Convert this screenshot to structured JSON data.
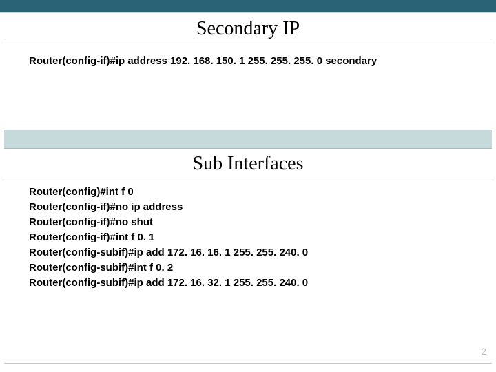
{
  "section1": {
    "title": "Secondary IP",
    "lines": [
      "Router(config-if)#ip address 192. 168. 150. 1 255. 255. 255. 0 secondary"
    ]
  },
  "section2": {
    "title": "Sub Interfaces",
    "lines": [
      "Router(config)#int f 0",
      "Router(config-if)#no ip address",
      "Router(config-if)#no shut",
      "Router(config-if)#int f 0. 1",
      "Router(config-subif)#ip add 172. 16. 16. 1 255. 255. 240. 0",
      "Router(config-subif)#int f 0. 2",
      "Router(config-subif)#ip add 172. 16. 32. 1 255. 255. 240. 0"
    ]
  },
  "page_number": "2"
}
